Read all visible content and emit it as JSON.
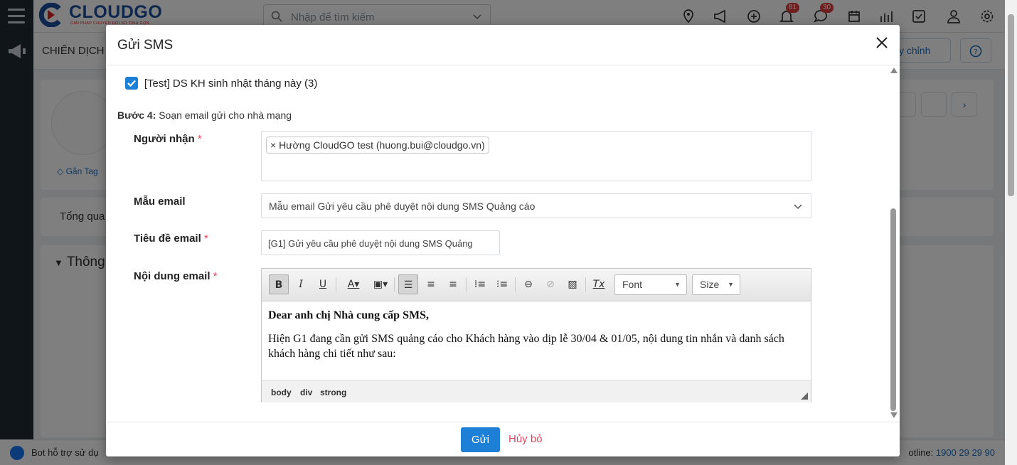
{
  "app": {
    "logo_text": "CLOUDGO",
    "logo_sub": "GIẢI PHÁP CHUYỂN ĐỔI SỐ TINH GỌN",
    "search_placeholder": "Nhập để tìm kiếm",
    "badges": {
      "notifications": "81",
      "messages": "30"
    },
    "page_title": "CHIẾN DỊCH",
    "right_btn_label": "y chỉnh",
    "tag_label": "Gắn Tag",
    "tab_overview": "Tổng qua",
    "section_info": "Thông",
    "bot_text": "Bot hỗ trợ sử dụ",
    "hotline_label": "otline:",
    "hotline_number": "1900 29 29 90"
  },
  "modal": {
    "title": "Gửi SMS",
    "checkbox_label": "[Test] DS KH sinh nhật tháng này (3)",
    "step_bold": "Bước 4:",
    "step_text": "Soạn email gửi cho nhà mạng",
    "fields": {
      "recipient_label": "Người nhận",
      "recipient_tag": "× Hường CloudGO test (huong.bui@cloudgo.vn)",
      "template_label": "Mẫu email",
      "template_value": "Mẫu email Gửi yêu cầu phê duyệt nội dung SMS Quảng cáo",
      "subject_label": "Tiêu đề email",
      "subject_value": "[G1] Gửi yêu cầu phê duyệt nội dung SMS Quảng",
      "content_label": "Nội dung email",
      "required_mark": "*"
    },
    "editor": {
      "font_combo": "Font",
      "size_combo": "Size",
      "greeting": "Dear anh chị Nhà cung cấp SMS,",
      "paragraph": "Hiện G1 đang cần gửi SMS quảng cáo cho Khách hàng vào dịp lễ 30/04 & 01/05, nội dung tin nhắn và danh sách khách hàng chi tiết như sau:",
      "path": [
        "body",
        "div",
        "strong"
      ]
    },
    "footer": {
      "send_label": "Gửi",
      "cancel_label": "Hủy bỏ"
    }
  },
  "colors": {
    "primary": "#1d7fd6",
    "danger": "#e0465f",
    "rail": "#1f2a33"
  }
}
